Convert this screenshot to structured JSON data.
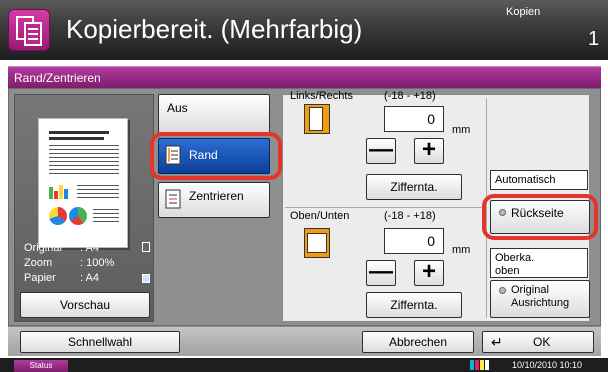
{
  "header": {
    "title": "Kopierbereit. (Mehrfarbig)",
    "mode": "Kopien",
    "page_number": "1",
    "icon": "copy-icon"
  },
  "dialog": {
    "title": "Rand/Zentrieren"
  },
  "preview": {
    "original_label": "Original",
    "original_value": ": A4",
    "zoom_label": "Zoom",
    "zoom_value": ": 100%",
    "paper_label": "Papier",
    "paper_value": ": A4",
    "button": "Vorschau"
  },
  "options": {
    "off": "Aus",
    "margin": "Rand",
    "center": "Zentrieren",
    "selected": "Rand"
  },
  "left_right": {
    "label": "Links/Rechts",
    "range": "(-18 - +18)",
    "value": "0",
    "unit": "mm",
    "minus": "—",
    "plus": "+",
    "fraction_button": "Ziffernta."
  },
  "top_bottom": {
    "label": "Oben/Unten",
    "range": "(-18 - +18)",
    "value": "0",
    "unit": "mm",
    "minus": "—",
    "plus": "+",
    "fraction_button": "Ziffernta."
  },
  "back_side": {
    "auto_label": "Automatisch",
    "back_button": "Rückseite",
    "top_edge_line1": "Oberka.",
    "top_edge_line2": "oben",
    "orientation_line1": "Original",
    "orientation_line2": "Ausrichtung"
  },
  "footer": {
    "quick": "Schnellwahl",
    "cancel": "Abbrechen",
    "ok": "OK"
  },
  "status": {
    "button": "Status",
    "datetime": "10/10/2010  10:10"
  },
  "colors": {
    "accent": "#9b2a87",
    "selected": "#1a55b8",
    "highlight": "#e4342c"
  }
}
